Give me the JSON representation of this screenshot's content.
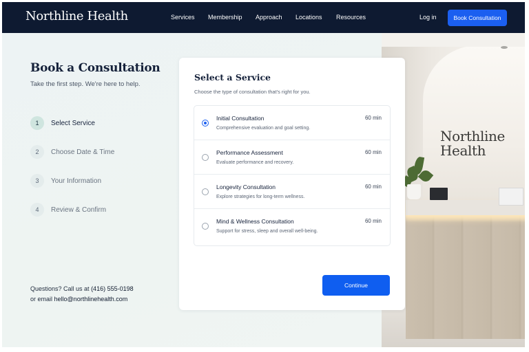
{
  "nav": {
    "brand": "Northline Health",
    "links": [
      "Services",
      "Membership",
      "Approach",
      "Locations",
      "Resources"
    ],
    "login": "Log in",
    "cta": "Book Consultation"
  },
  "left": {
    "title": "Book a Consultation",
    "subtitle": "Take the first step. We're here to help.",
    "steps": [
      {
        "num": "1",
        "label": "Select Service"
      },
      {
        "num": "2",
        "label": "Choose Date & Time"
      },
      {
        "num": "3",
        "label": "Your Information"
      },
      {
        "num": "4",
        "label": "Review & Confirm"
      }
    ],
    "contact": {
      "phone_prefix": "Questions? Call us at",
      "phone": "(416) 555-0198",
      "email_prefix": "or email",
      "email": "hello@northlinehealth.com"
    }
  },
  "card": {
    "title": "Select a Service",
    "subtitle": "Choose the type of consultation that's right for you.",
    "options": [
      {
        "name": "Initial Consultation",
        "desc": "Comprehensive evaluation and goal setting.",
        "duration": "60 min",
        "selected": true
      },
      {
        "name": "Performance Assessment",
        "desc": "Evaluate performance and recovery.",
        "duration": "60 min",
        "selected": false
      },
      {
        "name": "Longevity Consultation",
        "desc": "Explore strategies for long-term wellness.",
        "duration": "60 min",
        "selected": false
      },
      {
        "name": "Mind & Wellness Consultation",
        "desc": "Support for stress, sleep and overall well-being.",
        "duration": "60 min",
        "selected": false
      }
    ],
    "continue_label": "Continue"
  },
  "photo": {
    "sign": [
      "Northline",
      "Health"
    ]
  },
  "colors": {
    "nav_bg": "#0e1a31",
    "accent": "#1b5ff0",
    "step_active": "#cfe5df"
  }
}
